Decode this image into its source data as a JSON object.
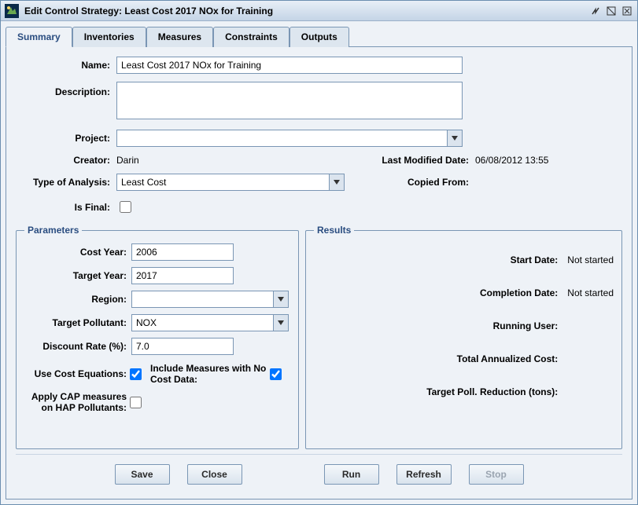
{
  "window": {
    "title": "Edit Control Strategy: Least Cost 2017 NOx for Training"
  },
  "tabs": [
    {
      "label": "Summary"
    },
    {
      "label": "Inventories"
    },
    {
      "label": "Measures"
    },
    {
      "label": "Constraints"
    },
    {
      "label": "Outputs"
    }
  ],
  "form": {
    "name_label": "Name:",
    "name_value": "Least Cost 2017 NOx for Training",
    "description_label": "Description:",
    "description_value": "",
    "project_label": "Project:",
    "project_value": "",
    "creator_label": "Creator:",
    "creator_value": "Darin",
    "last_modified_label": "Last Modified Date:",
    "last_modified_value": "06/08/2012 13:55",
    "type_analysis_label": "Type of Analysis:",
    "type_analysis_value": "Least Cost",
    "copied_from_label": "Copied From:",
    "copied_from_value": "",
    "is_final_label": "Is Final:"
  },
  "parameters": {
    "legend": "Parameters",
    "cost_year_label": "Cost Year:",
    "cost_year_value": "2006",
    "target_year_label": "Target Year:",
    "target_year_value": "2017",
    "region_label": "Region:",
    "region_value": "",
    "target_pollutant_label": "Target Pollutant:",
    "target_pollutant_value": "NOX",
    "discount_rate_label": "Discount Rate (%):",
    "discount_rate_value": "7.0",
    "use_cost_eq_label": "Use Cost Equations:",
    "include_measures_label": "Include Measures with No Cost Data:",
    "apply_cap_label": "Apply CAP measures on HAP Pollutants:"
  },
  "results": {
    "legend": "Results",
    "start_date_label": "Start Date:",
    "start_date_value": "Not started",
    "completion_date_label": "Completion Date:",
    "completion_date_value": "Not started",
    "running_user_label": "Running User:",
    "running_user_value": "",
    "total_cost_label": "Total Annualized Cost:",
    "total_cost_value": "",
    "target_reduction_label": "Target Poll. Reduction (tons):",
    "target_reduction_value": ""
  },
  "buttons": {
    "save": "Save",
    "close": "Close",
    "run": "Run",
    "refresh": "Refresh",
    "stop": "Stop"
  }
}
